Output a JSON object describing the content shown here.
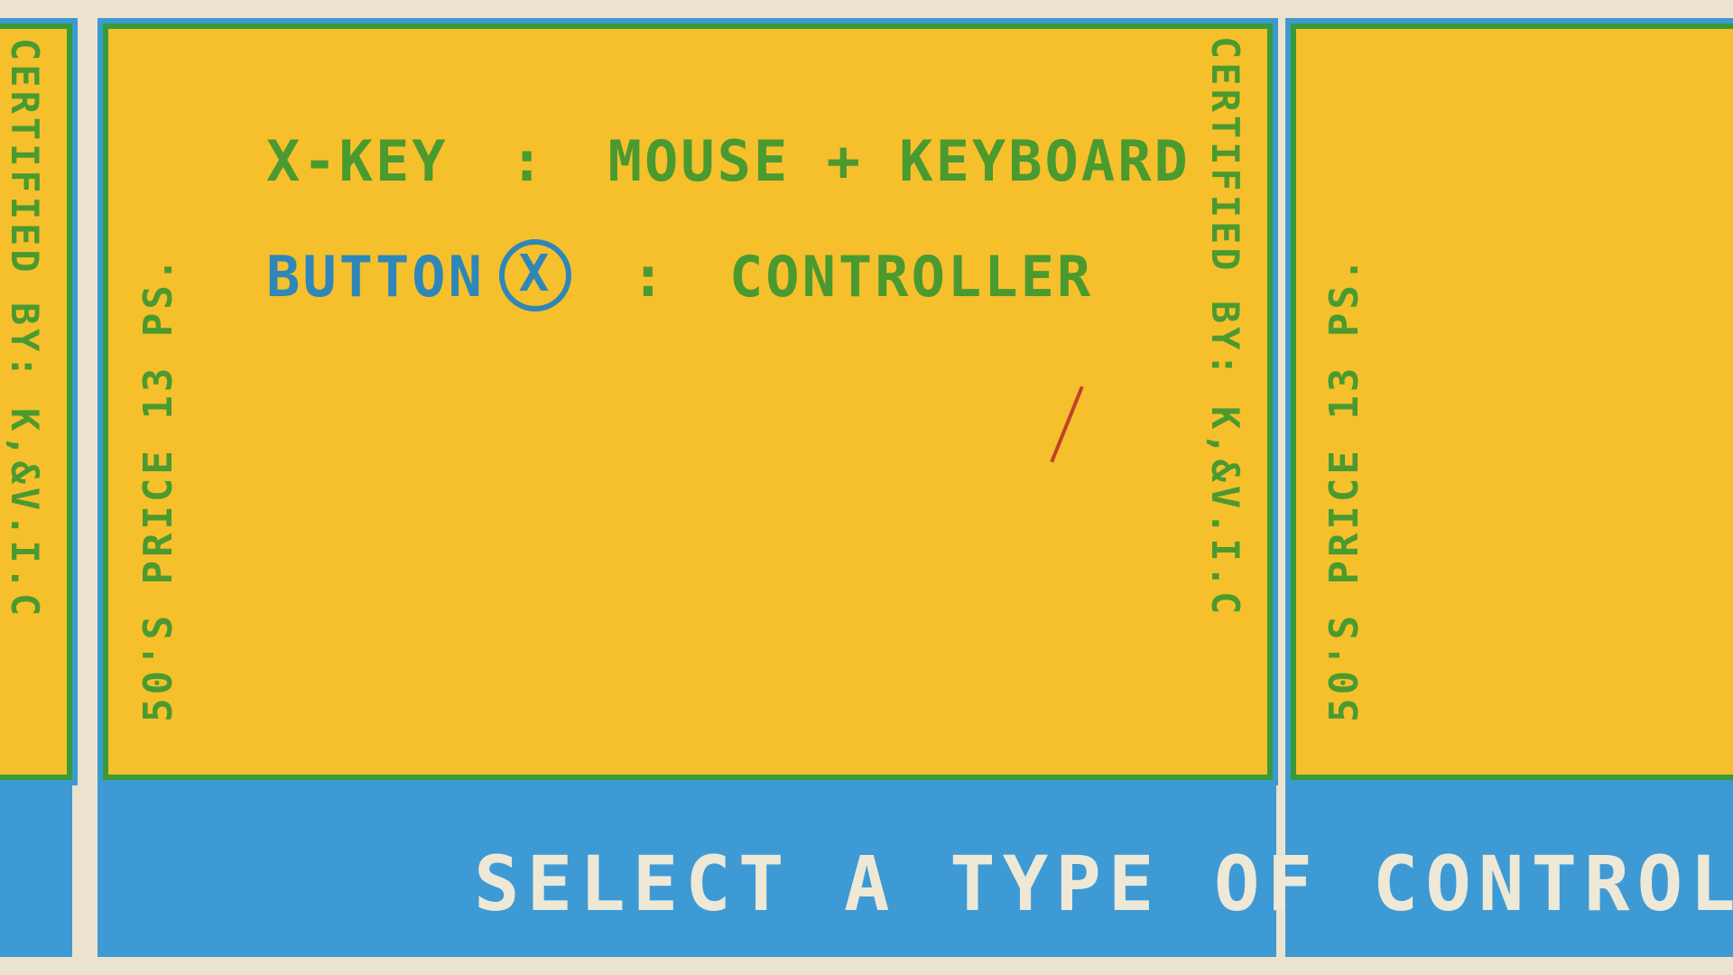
{
  "ticket": {
    "certified_text": "CERTIFIED BY: K,&V.I.C",
    "price_text": "50'S PRICE 13 PS."
  },
  "options": {
    "keyboard": {
      "key_label": "X-KEY",
      "separator": ":",
      "mode_label": "MOUSE + KEYBOARD"
    },
    "controller": {
      "button_label": "BUTTON",
      "button_glyph": "X",
      "separator": ":",
      "mode_label": "CONTROLLER"
    }
  },
  "footer": {
    "prompt": "SELECT A TYPE OF CONTROL"
  },
  "colors": {
    "ticket_yellow": "#f5c02c",
    "ticket_blue": "#3e9ad4",
    "ink_green": "#4a9a30",
    "ink_blue": "#2f86b8",
    "paper": "#ece3cf"
  }
}
